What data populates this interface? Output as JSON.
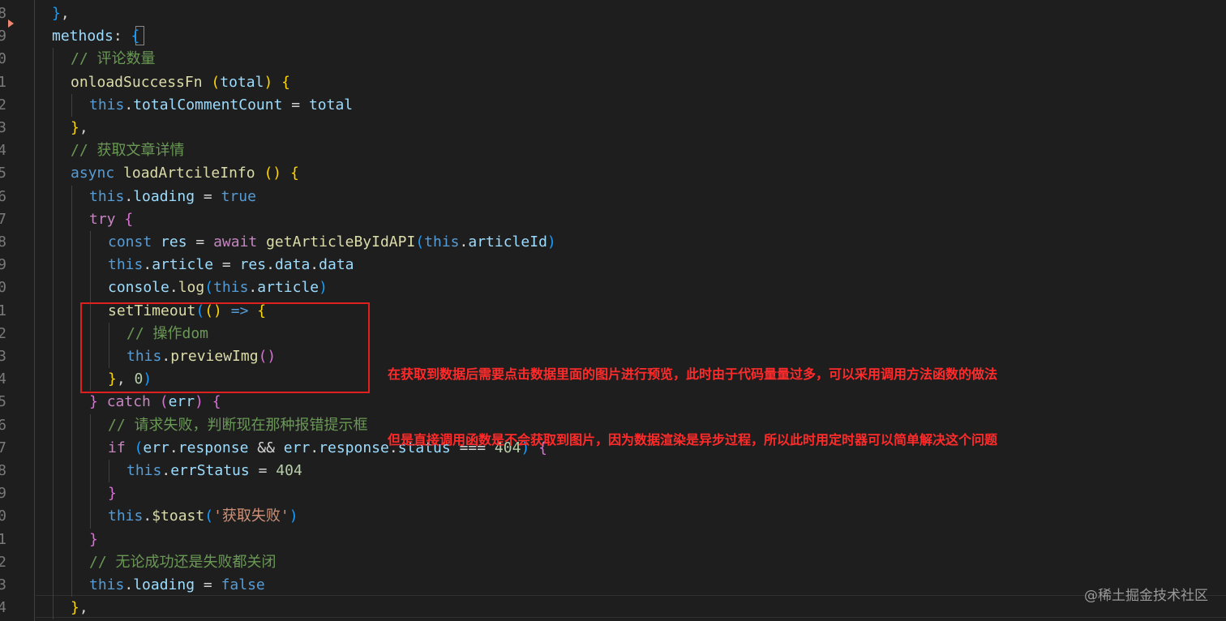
{
  "editor": {
    "colors": {
      "background": "#1e1e1e",
      "annotation": "#ff2b2b",
      "highlight_box": "#e0201f"
    },
    "line_numbers": [
      "8",
      "9",
      "0",
      "1",
      "2",
      "3",
      "4",
      "5",
      "6",
      "7",
      "8",
      "9",
      "0",
      "1",
      "2",
      "3",
      "4",
      "5",
      "6",
      "7",
      "8",
      "9",
      "0",
      "1",
      "2",
      "3",
      "4"
    ],
    "lines": [
      {
        "indent": 0,
        "tokens": [
          {
            "t": "}",
            "c": "t-br3"
          },
          {
            "t": ",",
            "c": "t-punc"
          }
        ]
      },
      {
        "indent": 0,
        "tokens": [
          {
            "t": "methods",
            "c": "t-prop"
          },
          {
            "t": ": ",
            "c": "t-punc"
          },
          {
            "t": "{",
            "c": "t-br3"
          }
        ]
      },
      {
        "indent": 1,
        "tokens": [
          {
            "t": "// 评论数量",
            "c": "t-com"
          }
        ]
      },
      {
        "indent": 1,
        "tokens": [
          {
            "t": "onloadSuccessFn",
            "c": "t-func"
          },
          {
            "t": " ",
            "c": "t-punc"
          },
          {
            "t": "(",
            "c": "t-br1"
          },
          {
            "t": "total",
            "c": "t-var"
          },
          {
            "t": ")",
            "c": "t-br1"
          },
          {
            "t": " ",
            "c": "t-punc"
          },
          {
            "t": "{",
            "c": "t-br1"
          }
        ]
      },
      {
        "indent": 2,
        "tokens": [
          {
            "t": "this",
            "c": "t-kw"
          },
          {
            "t": ".",
            "c": "t-punc"
          },
          {
            "t": "totalCommentCount",
            "c": "t-prop"
          },
          {
            "t": " = ",
            "c": "t-punc"
          },
          {
            "t": "total",
            "c": "t-var"
          }
        ]
      },
      {
        "indent": 1,
        "tokens": [
          {
            "t": "}",
            "c": "t-br1"
          },
          {
            "t": ",",
            "c": "t-punc"
          }
        ]
      },
      {
        "indent": 1,
        "tokens": [
          {
            "t": "// 获取文章详情",
            "c": "t-com"
          }
        ]
      },
      {
        "indent": 1,
        "tokens": [
          {
            "t": "async",
            "c": "t-kw"
          },
          {
            "t": " ",
            "c": "t-punc"
          },
          {
            "t": "loadArtcileInfo",
            "c": "t-func"
          },
          {
            "t": " ",
            "c": "t-punc"
          },
          {
            "t": "()",
            "c": "t-br1"
          },
          {
            "t": " ",
            "c": "t-punc"
          },
          {
            "t": "{",
            "c": "t-br1"
          }
        ]
      },
      {
        "indent": 2,
        "tokens": [
          {
            "t": "this",
            "c": "t-kw"
          },
          {
            "t": ".",
            "c": "t-punc"
          },
          {
            "t": "loading",
            "c": "t-prop"
          },
          {
            "t": " = ",
            "c": "t-punc"
          },
          {
            "t": "true",
            "c": "t-kw"
          }
        ]
      },
      {
        "indent": 2,
        "tokens": [
          {
            "t": "try",
            "c": "t-ctrl"
          },
          {
            "t": " ",
            "c": "t-punc"
          },
          {
            "t": "{",
            "c": "t-br2"
          }
        ]
      },
      {
        "indent": 3,
        "tokens": [
          {
            "t": "const",
            "c": "t-kw"
          },
          {
            "t": " ",
            "c": "t-punc"
          },
          {
            "t": "res",
            "c": "t-var"
          },
          {
            "t": " = ",
            "c": "t-punc"
          },
          {
            "t": "await",
            "c": "t-ctrl"
          },
          {
            "t": " ",
            "c": "t-punc"
          },
          {
            "t": "getArticleByIdAPI",
            "c": "t-func"
          },
          {
            "t": "(",
            "c": "t-br3"
          },
          {
            "t": "this",
            "c": "t-kw"
          },
          {
            "t": ".",
            "c": "t-punc"
          },
          {
            "t": "articleId",
            "c": "t-prop"
          },
          {
            "t": ")",
            "c": "t-br3"
          }
        ]
      },
      {
        "indent": 3,
        "tokens": [
          {
            "t": "this",
            "c": "t-kw"
          },
          {
            "t": ".",
            "c": "t-punc"
          },
          {
            "t": "article",
            "c": "t-prop"
          },
          {
            "t": " = ",
            "c": "t-punc"
          },
          {
            "t": "res",
            "c": "t-var"
          },
          {
            "t": ".",
            "c": "t-punc"
          },
          {
            "t": "data",
            "c": "t-prop"
          },
          {
            "t": ".",
            "c": "t-punc"
          },
          {
            "t": "data",
            "c": "t-prop"
          }
        ]
      },
      {
        "indent": 3,
        "tokens": [
          {
            "t": "console",
            "c": "t-var"
          },
          {
            "t": ".",
            "c": "t-punc"
          },
          {
            "t": "log",
            "c": "t-func"
          },
          {
            "t": "(",
            "c": "t-br3"
          },
          {
            "t": "this",
            "c": "t-kw"
          },
          {
            "t": ".",
            "c": "t-punc"
          },
          {
            "t": "article",
            "c": "t-prop"
          },
          {
            "t": ")",
            "c": "t-br3"
          }
        ]
      },
      {
        "indent": 3,
        "tokens": [
          {
            "t": "setTimeout",
            "c": "t-func"
          },
          {
            "t": "(",
            "c": "t-br3"
          },
          {
            "t": "()",
            "c": "t-br1"
          },
          {
            "t": " ",
            "c": "t-punc"
          },
          {
            "t": "=>",
            "c": "t-kw"
          },
          {
            "t": " ",
            "c": "t-punc"
          },
          {
            "t": "{",
            "c": "t-br1"
          }
        ]
      },
      {
        "indent": 4,
        "tokens": [
          {
            "t": "// 操作dom",
            "c": "t-com"
          }
        ]
      },
      {
        "indent": 4,
        "tokens": [
          {
            "t": "this",
            "c": "t-kw"
          },
          {
            "t": ".",
            "c": "t-punc"
          },
          {
            "t": "previewImg",
            "c": "t-func"
          },
          {
            "t": "()",
            "c": "t-br2"
          }
        ]
      },
      {
        "indent": 3,
        "tokens": [
          {
            "t": "}",
            "c": "t-br1"
          },
          {
            "t": ", ",
            "c": "t-punc"
          },
          {
            "t": "0",
            "c": "t-num"
          },
          {
            "t": ")",
            "c": "t-br3"
          }
        ]
      },
      {
        "indent": 2,
        "tokens": [
          {
            "t": "}",
            "c": "t-br2"
          },
          {
            "t": " ",
            "c": "t-punc"
          },
          {
            "t": "catch",
            "c": "t-ctrl"
          },
          {
            "t": " ",
            "c": "t-punc"
          },
          {
            "t": "(",
            "c": "t-br2"
          },
          {
            "t": "err",
            "c": "t-var"
          },
          {
            "t": ")",
            "c": "t-br2"
          },
          {
            "t": " ",
            "c": "t-punc"
          },
          {
            "t": "{",
            "c": "t-br2"
          }
        ]
      },
      {
        "indent": 3,
        "tokens": [
          {
            "t": "// 请求失败，判断现在那种报错提示框",
            "c": "t-com"
          }
        ]
      },
      {
        "indent": 3,
        "tokens": [
          {
            "t": "if",
            "c": "t-ctrl"
          },
          {
            "t": " ",
            "c": "t-punc"
          },
          {
            "t": "(",
            "c": "t-br3"
          },
          {
            "t": "err",
            "c": "t-var"
          },
          {
            "t": ".",
            "c": "t-punc"
          },
          {
            "t": "response",
            "c": "t-prop"
          },
          {
            "t": " && ",
            "c": "t-punc"
          },
          {
            "t": "err",
            "c": "t-var"
          },
          {
            "t": ".",
            "c": "t-punc"
          },
          {
            "t": "response",
            "c": "t-prop"
          },
          {
            "t": ".",
            "c": "t-punc"
          },
          {
            "t": "status",
            "c": "t-prop"
          },
          {
            "t": " === ",
            "c": "t-punc"
          },
          {
            "t": "404",
            "c": "t-num"
          },
          {
            "t": ")",
            "c": "t-br3"
          },
          {
            "t": " ",
            "c": "t-punc"
          },
          {
            "t": "{",
            "c": "t-br2"
          }
        ]
      },
      {
        "indent": 4,
        "tokens": [
          {
            "t": "this",
            "c": "t-kw"
          },
          {
            "t": ".",
            "c": "t-punc"
          },
          {
            "t": "errStatus",
            "c": "t-prop"
          },
          {
            "t": " = ",
            "c": "t-punc"
          },
          {
            "t": "404",
            "c": "t-num"
          }
        ]
      },
      {
        "indent": 3,
        "tokens": [
          {
            "t": "}",
            "c": "t-br2"
          }
        ]
      },
      {
        "indent": 3,
        "tokens": [
          {
            "t": "this",
            "c": "t-kw"
          },
          {
            "t": ".",
            "c": "t-punc"
          },
          {
            "t": "$toast",
            "c": "t-func"
          },
          {
            "t": "(",
            "c": "t-br3"
          },
          {
            "t": "'获取失败'",
            "c": "t-str"
          },
          {
            "t": ")",
            "c": "t-br3"
          }
        ]
      },
      {
        "indent": 2,
        "tokens": [
          {
            "t": "}",
            "c": "t-br2"
          }
        ]
      },
      {
        "indent": 2,
        "tokens": [
          {
            "t": "// 无论成功还是失败都关闭",
            "c": "t-com"
          }
        ]
      },
      {
        "indent": 2,
        "tokens": [
          {
            "t": "this",
            "c": "t-kw"
          },
          {
            "t": ".",
            "c": "t-punc"
          },
          {
            "t": "loading",
            "c": "t-prop"
          },
          {
            "t": " = ",
            "c": "t-punc"
          },
          {
            "t": "false",
            "c": "t-kw"
          }
        ]
      },
      {
        "indent": 1,
        "tokens": [
          {
            "t": "}",
            "c": "t-br1"
          },
          {
            "t": ",",
            "c": "t-punc"
          }
        ]
      }
    ]
  },
  "annotation": {
    "line1": "在获取到数据后需要点击数据里面的图片进行预览，此时由于代码量量过多，可以采用调用方法函数的做法",
    "line2": "但是直接调用函数是不会获取到图片，因为数据渲染是异步过程，所以此时用定时器可以简单解决这个问题"
  },
  "watermark": "@稀土掘金技术社区"
}
